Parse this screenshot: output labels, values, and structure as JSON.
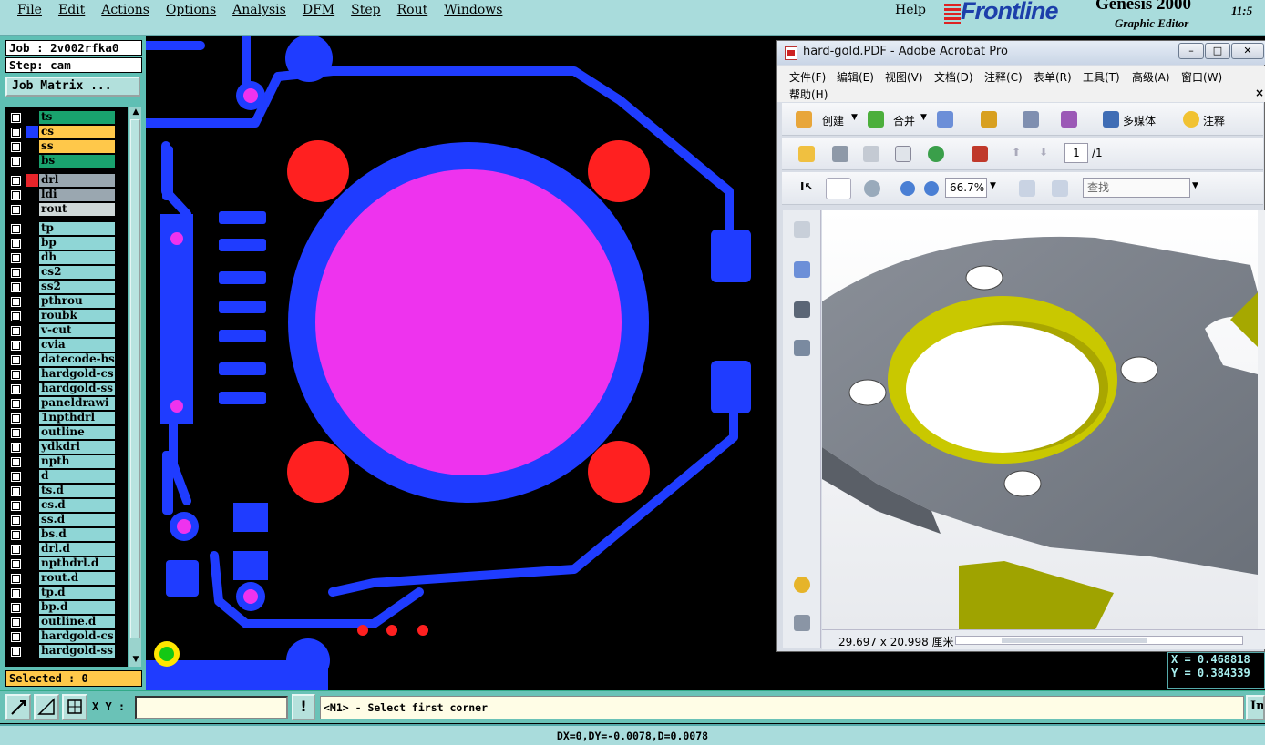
{
  "app": {
    "menus": [
      "File",
      "Edit",
      "Actions",
      "Options",
      "Analysis",
      "DFM",
      "Step",
      "Rout",
      "Windows"
    ],
    "help": "Help",
    "brand": "Frontline",
    "product": "Genesis 2000",
    "product_sub": "Graphic Editor",
    "clock": "11:5"
  },
  "left": {
    "job": "Job : 2v002rfka0",
    "step": "Step: cam",
    "job_matrix": "Job Matrix ...",
    "selected": "Selected : 0",
    "layers": [
      {
        "name": "ts",
        "color": "#19a26e",
        "swatch": "#000000"
      },
      {
        "name": "cs",
        "color": "#ffc84a",
        "swatch": "#1f3cff"
      },
      {
        "name": "ss",
        "color": "#ffc84a",
        "swatch": "#000000"
      },
      {
        "name": "bs",
        "color": "#19a26e",
        "swatch": "#000000"
      },
      {
        "name": "drl",
        "color": "#9aa7b0",
        "swatch": "#e8242a",
        "gap": true
      },
      {
        "name": "ldi",
        "color": "#9aa7b0",
        "swatch": "#000000"
      },
      {
        "name": "rout",
        "color": "#cfd8d8",
        "swatch": "#000000"
      },
      {
        "name": "tp",
        "color": "#8fd6d6",
        "swatch": "#000000",
        "gap": true
      },
      {
        "name": "bp",
        "color": "#8fd6d6",
        "swatch": "#000000"
      },
      {
        "name": "dh",
        "color": "#8fd6d6",
        "swatch": "#000000"
      },
      {
        "name": "cs2",
        "color": "#8fd6d6",
        "swatch": "#000000"
      },
      {
        "name": "ss2",
        "color": "#8fd6d6",
        "swatch": "#000000"
      },
      {
        "name": "pthrou",
        "color": "#8fd6d6",
        "swatch": "#000000"
      },
      {
        "name": "roubk",
        "color": "#8fd6d6",
        "swatch": "#000000"
      },
      {
        "name": "v-cut",
        "color": "#8fd6d6",
        "swatch": "#000000"
      },
      {
        "name": "cvia",
        "color": "#8fd6d6",
        "swatch": "#000000"
      },
      {
        "name": "datecode-bs",
        "color": "#8fd6d6",
        "swatch": "#000000"
      },
      {
        "name": "hardgold-cs",
        "color": "#8fd6d6",
        "swatch": "#000000"
      },
      {
        "name": "hardgold-ss",
        "color": "#8fd6d6",
        "swatch": "#000000"
      },
      {
        "name": "paneldrawi",
        "color": "#8fd6d6",
        "swatch": "#000000"
      },
      {
        "name": "1npthdrl",
        "color": "#8fd6d6",
        "swatch": "#000000"
      },
      {
        "name": "outline",
        "color": "#8fd6d6",
        "swatch": "#000000"
      },
      {
        "name": "ydkdrl",
        "color": "#8fd6d6",
        "swatch": "#000000"
      },
      {
        "name": "npth",
        "color": "#8fd6d6",
        "swatch": "#000000"
      },
      {
        "name": "d",
        "color": "#8fd6d6",
        "swatch": "#000000"
      },
      {
        "name": "ts.d",
        "color": "#8fd6d6",
        "swatch": "#000000"
      },
      {
        "name": "cs.d",
        "color": "#8fd6d6",
        "swatch": "#000000"
      },
      {
        "name": "ss.d",
        "color": "#8fd6d6",
        "swatch": "#000000"
      },
      {
        "name": "bs.d",
        "color": "#8fd6d6",
        "swatch": "#000000"
      },
      {
        "name": "drl.d",
        "color": "#8fd6d6",
        "swatch": "#000000"
      },
      {
        "name": "npthdrl.d",
        "color": "#8fd6d6",
        "swatch": "#000000"
      },
      {
        "name": "rout.d",
        "color": "#8fd6d6",
        "swatch": "#000000"
      },
      {
        "name": "tp.d",
        "color": "#8fd6d6",
        "swatch": "#000000"
      },
      {
        "name": "bp.d",
        "color": "#8fd6d6",
        "swatch": "#000000"
      },
      {
        "name": "outline.d",
        "color": "#8fd6d6",
        "swatch": "#000000"
      },
      {
        "name": "hardgold-cs",
        "color": "#8fd6d6",
        "swatch": "#000000"
      },
      {
        "name": "hardgold-ss",
        "color": "#8fd6d6",
        "swatch": "#000000"
      }
    ]
  },
  "acrobat": {
    "title": "hard-gold.PDF - Adobe Acrobat Pro",
    "menu_row1": [
      "文件(F)",
      "编辑(E)",
      "视图(V)",
      "文档(D)",
      "注释(C)",
      "表单(R)",
      "工具(T)",
      "高级(A)",
      "窗口(W)"
    ],
    "menu_row2": "帮助(H)",
    "toolbar": {
      "create": "创建",
      "merge": "合并",
      "multimedia": "多媒体",
      "comment": "注释"
    },
    "page_current": "1",
    "page_total": "/1",
    "zoom": "66.7%",
    "find_placeholder": "查找",
    "page_size": "29.697 x 20.998 厘米"
  },
  "coords": {
    "x": "X = 0.468818",
    "y": "Y = 0.384339"
  },
  "cmd": {
    "xy_label": "X Y :",
    "xy_value": "",
    "bang": "!",
    "prompt": "<M1> - Select first corner",
    "right_btn": "In"
  },
  "status": "DX=0,DY=-0.0078,D=0.0078",
  "colors": {
    "copper": "#1f3cff",
    "drill": "#ff2020",
    "pad_pink": "#ee33ee",
    "bg": "#000000",
    "accent_teal": "#5fbfb4"
  }
}
